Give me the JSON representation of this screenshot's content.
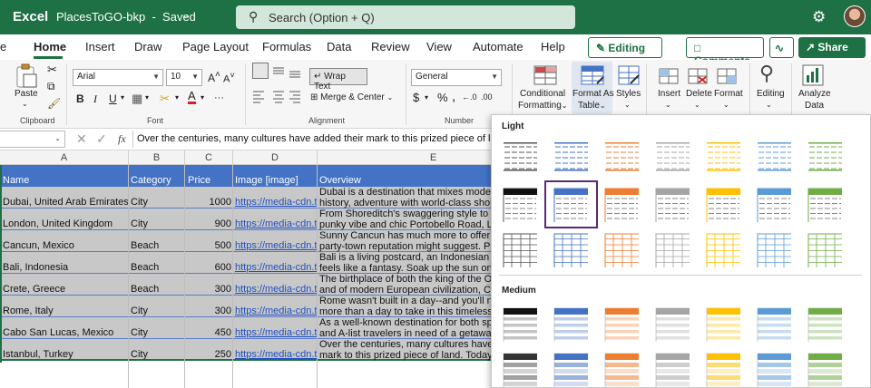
{
  "titlebar": {
    "app_name": "Excel",
    "document_name": "PlacesToGO-bkp",
    "save_status": "Saved",
    "search_placeholder": "Search (Option + Q)"
  },
  "tabs": [
    "Home",
    "Insert",
    "Draw",
    "Page Layout",
    "Formulas",
    "Data",
    "Review",
    "View",
    "Automate",
    "Help"
  ],
  "active_tab": "Home",
  "actions": {
    "editing_label": "Editing",
    "comments_label": "Comments",
    "share_label": "Share"
  },
  "ribbon": {
    "clipboard": {
      "paste_label": "Paste",
      "group_label": "Clipboard"
    },
    "font": {
      "font_name": "Arial",
      "font_size": "10",
      "group_label": "Font"
    },
    "alignment": {
      "wrap_text_label": "Wrap Text",
      "merge_center_label": "Merge & Center",
      "group_label": "Alignment"
    },
    "number": {
      "format": "General",
      "group_label": "Number"
    },
    "styles": {
      "conditional_formatting_l1": "Conditional",
      "conditional_formatting_l2": "Formatting",
      "format_as_table_l1": "Format As",
      "format_as_table_l2": "Table",
      "styles_label": "Styles"
    },
    "cells": {
      "insert_label": "Insert",
      "delete_label": "Delete",
      "format_label": "Format"
    },
    "editing": {
      "editing_label": "Editing"
    },
    "analyze": {
      "analyze_l1": "Analyze",
      "analyze_l2": "Data"
    }
  },
  "formula_bar": {
    "fx_label": "fx",
    "formula": "Over the centuries, many cultures have added their mark to this prized piece of lan"
  },
  "columns": [
    "A",
    "B",
    "C",
    "D",
    "E"
  ],
  "table": {
    "headers": [
      "Name",
      "Category",
      "Price",
      "Image [image]",
      "Overview"
    ],
    "rows": [
      {
        "name": "Dubai, United Arab Emirates",
        "category": "City",
        "price": "1000",
        "image": "https://media-cdn.t",
        "overview_1": "Dubai is a destination that mixes moderr",
        "overview_2": "history, adventure with world-class shopp"
      },
      {
        "name": "London, United Kingdom",
        "category": "City",
        "price": "900",
        "image": "https://media-cdn.t",
        "overview_1": "From Shoreditch's swaggering style to C",
        "overview_2": "punky vibe and chic Portobello Road, Lo"
      },
      {
        "name": "Cancun, Mexico",
        "category": "Beach",
        "price": "500",
        "image": "https://media-cdn.t",
        "overview_1": "Sunny Cancun has much more to offer th",
        "overview_2": "party-town reputation might suggest. Ple"
      },
      {
        "name": "Bali, Indonesia",
        "category": "Beach",
        "price": "600",
        "image": "https://media-cdn.t",
        "overview_1": "Bali is a living postcard, an Indonesian p",
        "overview_2": "feels like a fantasy. Soak up the sun on a"
      },
      {
        "name": "Crete, Greece",
        "category": "Beach",
        "price": "300",
        "image": "https://media-cdn.t",
        "overview_1": "The birthplace of both the king of the Oly",
        "overview_2": "and of modern European civilization, Cre"
      },
      {
        "name": "Rome, Italy",
        "category": "City",
        "price": "300",
        "image": "https://media-cdn.t",
        "overview_1": "Rome wasn't built in a day--and you'll ne",
        "overview_2": "more than a day to take in this timeless c"
      },
      {
        "name": "Cabo San Lucas, Mexico",
        "category": "City",
        "price": "450",
        "image": "https://media-cdn.t",
        "overview_1": "As a well-known destination for both spri",
        "overview_2": "and A-list travelers in need of a getaway,"
      },
      {
        "name": "Istanbul, Turkey",
        "category": "City",
        "price": "250",
        "image": "https://media-cdn.t",
        "overview_1": "Over the centuries, many cultures have a",
        "overview_2": "mark to this prized piece of land. Today,"
      }
    ]
  },
  "gallery": {
    "light_label": "Light",
    "medium_label": "Medium",
    "colors": [
      "#555555",
      "#4472c4",
      "#ed7d31",
      "#a5a5a5",
      "#ffc000",
      "#5b9bd5",
      "#70ad47"
    ]
  }
}
